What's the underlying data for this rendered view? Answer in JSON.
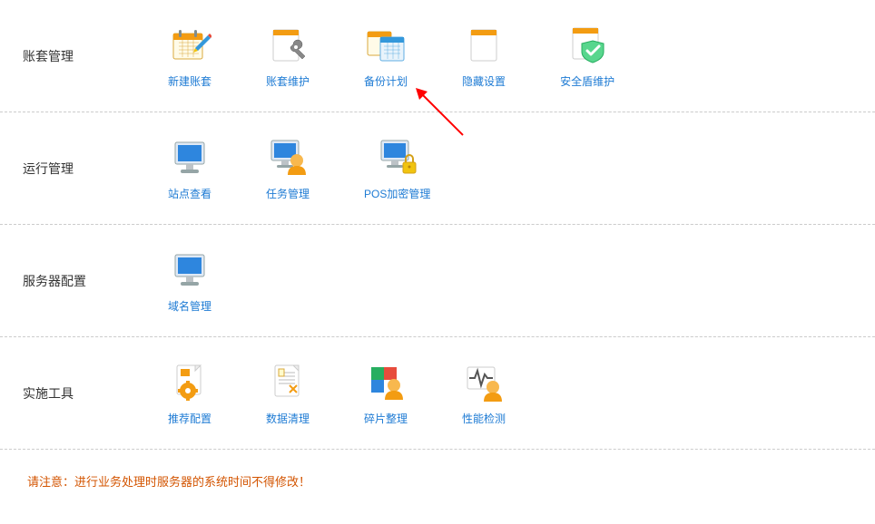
{
  "sections": [
    {
      "label": "账套管理",
      "items": [
        {
          "name": "new-account",
          "label": "新建账套",
          "icon": "calendar-pencil"
        },
        {
          "name": "account-maintain",
          "label": "账套维护",
          "icon": "page-wrench"
        },
        {
          "name": "backup-plan",
          "label": "备份计划",
          "icon": "calendars"
        },
        {
          "name": "hidden-settings",
          "label": "隐藏设置",
          "icon": "page-orange"
        },
        {
          "name": "security-shield",
          "label": "安全盾维护",
          "icon": "shield-check"
        }
      ]
    },
    {
      "label": "运行管理",
      "items": [
        {
          "name": "site-view",
          "label": "站点查看",
          "icon": "monitor-blue"
        },
        {
          "name": "task-manage",
          "label": "任务管理",
          "icon": "monitor-user"
        },
        {
          "name": "pos-encrypt",
          "label": "POS加密管理",
          "icon": "monitor-lock"
        }
      ]
    },
    {
      "label": "服务器配置",
      "items": [
        {
          "name": "domain-manage",
          "label": "域名管理",
          "icon": "monitor-blue"
        }
      ]
    },
    {
      "label": "实施工具",
      "items": [
        {
          "name": "recommend-config",
          "label": "推荐配置",
          "icon": "page-gear"
        },
        {
          "name": "data-clean",
          "label": "数据清理",
          "icon": "page-lines"
        },
        {
          "name": "fragment-sort",
          "label": "碎片整理",
          "icon": "puzzle-user"
        },
        {
          "name": "performance-test",
          "label": "性能检测",
          "icon": "pulse-user"
        }
      ]
    }
  ],
  "notice": "请注意：进行业务处理时服务器的系统时间不得修改！"
}
